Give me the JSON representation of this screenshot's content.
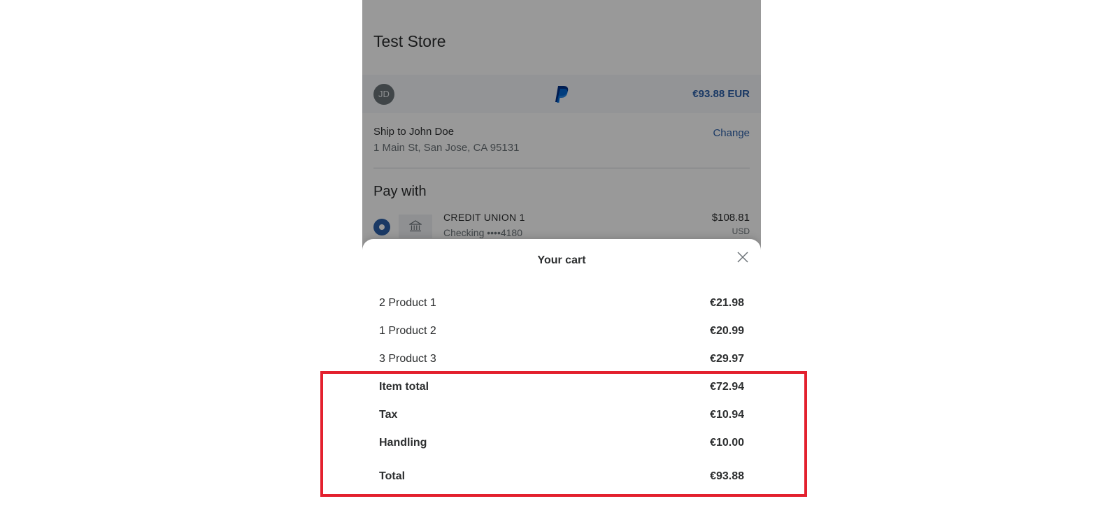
{
  "store": {
    "title": "Test Store"
  },
  "account": {
    "avatar_initials": "JD",
    "amount": "€93.88 EUR"
  },
  "shipping": {
    "name": "Ship to John Doe",
    "address": "1 Main St, San Jose, CA 95131",
    "change_label": "Change"
  },
  "pay_with": {
    "title": "Pay with",
    "bank_name": "CREDIT UNION 1",
    "account": "Checking ••••4180",
    "amount": "$108.81",
    "currency": "USD"
  },
  "cart": {
    "title": "Your cart",
    "items": [
      {
        "label": "2 Product 1",
        "price": "€21.98"
      },
      {
        "label": "1 Product 2",
        "price": "€20.99"
      },
      {
        "label": "3 Product 3",
        "price": "€29.97"
      }
    ],
    "item_total": {
      "label": "Item total",
      "price": "€72.94"
    },
    "tax": {
      "label": "Tax",
      "price": "€10.94"
    },
    "handling": {
      "label": "Handling",
      "price": "€10.00"
    },
    "total": {
      "label": "Total",
      "price": "€93.88"
    }
  },
  "colors": {
    "accent": "#2c5fa8",
    "highlight": "#e3202e"
  }
}
